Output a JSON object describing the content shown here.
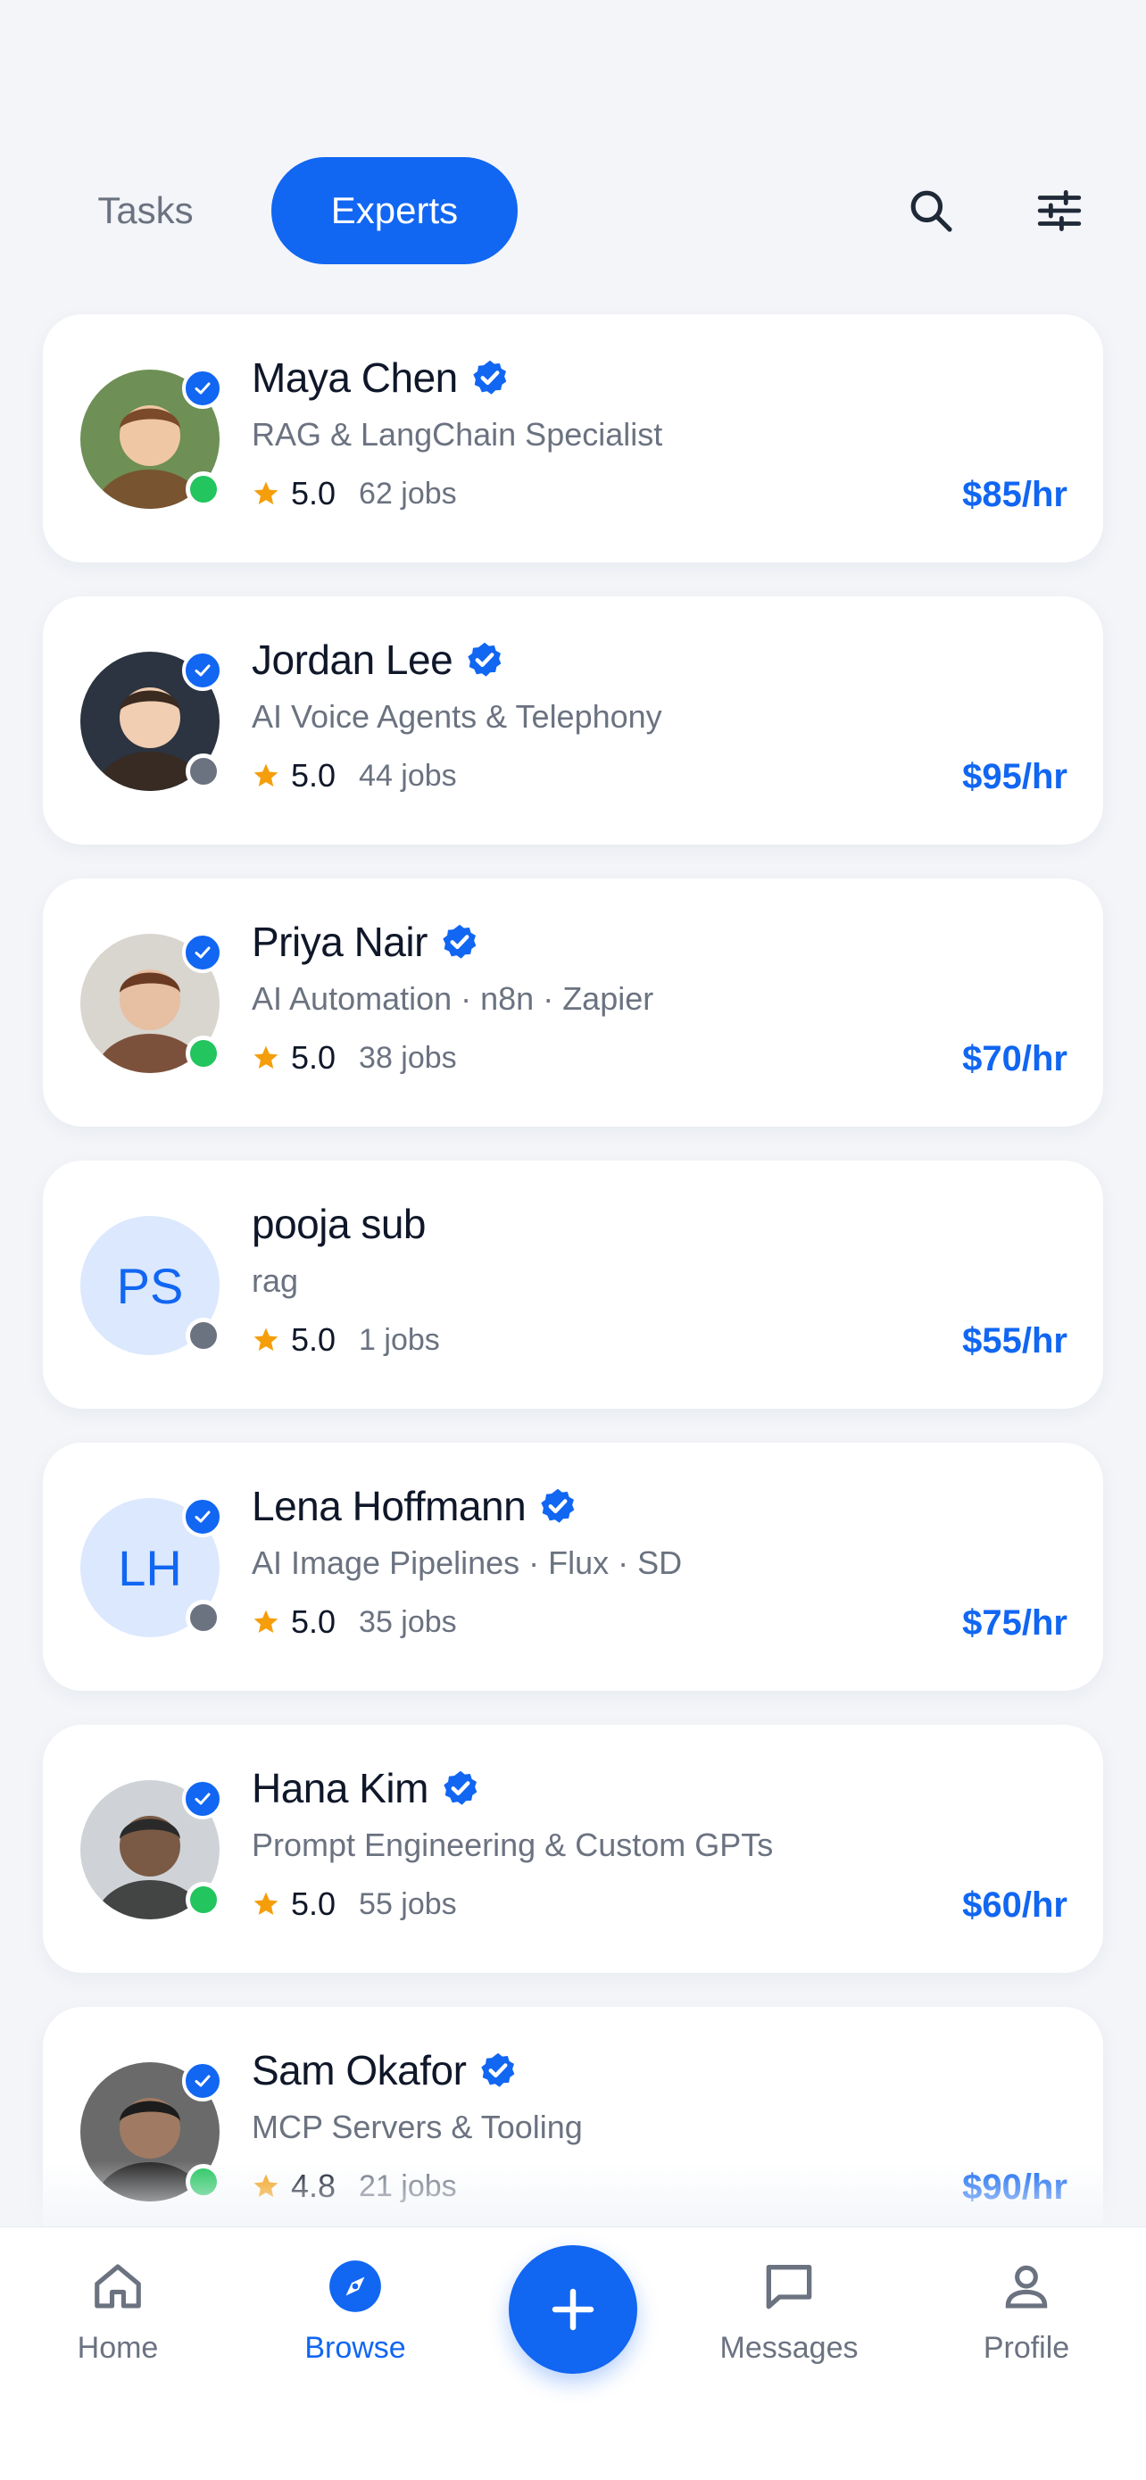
{
  "tabs": {
    "tasks": "Tasks",
    "experts": "Experts"
  },
  "colors": {
    "accent": "#1166f2",
    "online": "#22c55e",
    "offline": "#6b7280",
    "star": "#f59e0b"
  },
  "experts": [
    {
      "name": "Maya Chen",
      "specialty": "RAG & LangChain Specialist",
      "rating": "5.0",
      "jobs": "62 jobs",
      "rate": "$85/hr",
      "verified": true,
      "status": "online",
      "avatar": "photo"
    },
    {
      "name": "Jordan Lee",
      "specialty": "AI Voice Agents & Telephony",
      "rating": "5.0",
      "jobs": "44 jobs",
      "rate": "$95/hr",
      "verified": true,
      "status": "offline",
      "avatar": "photo"
    },
    {
      "name": "Priya Nair",
      "specialty": "AI Automation · n8n · Zapier",
      "rating": "5.0",
      "jobs": "38 jobs",
      "rate": "$70/hr",
      "verified": true,
      "status": "online",
      "avatar": "photo"
    },
    {
      "name": "pooja sub",
      "specialty": "rag",
      "rating": "5.0",
      "jobs": "1 jobs",
      "rate": "$55/hr",
      "verified": false,
      "status": "offline",
      "avatar": "initials",
      "initials": "PS"
    },
    {
      "name": "Lena Hoffmann",
      "specialty": "AI Image Pipelines · Flux · SD",
      "rating": "5.0",
      "jobs": "35 jobs",
      "rate": "$75/hr",
      "verified": true,
      "status": "offline",
      "avatar": "initials",
      "initials": "LH"
    },
    {
      "name": "Hana Kim",
      "specialty": "Prompt Engineering & Custom GPTs",
      "rating": "5.0",
      "jobs": "55 jobs",
      "rate": "$60/hr",
      "verified": true,
      "status": "online",
      "avatar": "photo"
    },
    {
      "name": "Sam Okafor",
      "specialty": "MCP Servers & Tooling",
      "rating": "4.8",
      "jobs": "21 jobs",
      "rate": "$90/hr",
      "verified": true,
      "status": "online",
      "avatar": "photo"
    }
  ],
  "nav": {
    "home": "Home",
    "browse": "Browse",
    "messages": "Messages",
    "profile": "Profile"
  },
  "icons": {
    "search": "search-icon",
    "filter": "filter-sliders-icon",
    "add": "plus-icon"
  }
}
